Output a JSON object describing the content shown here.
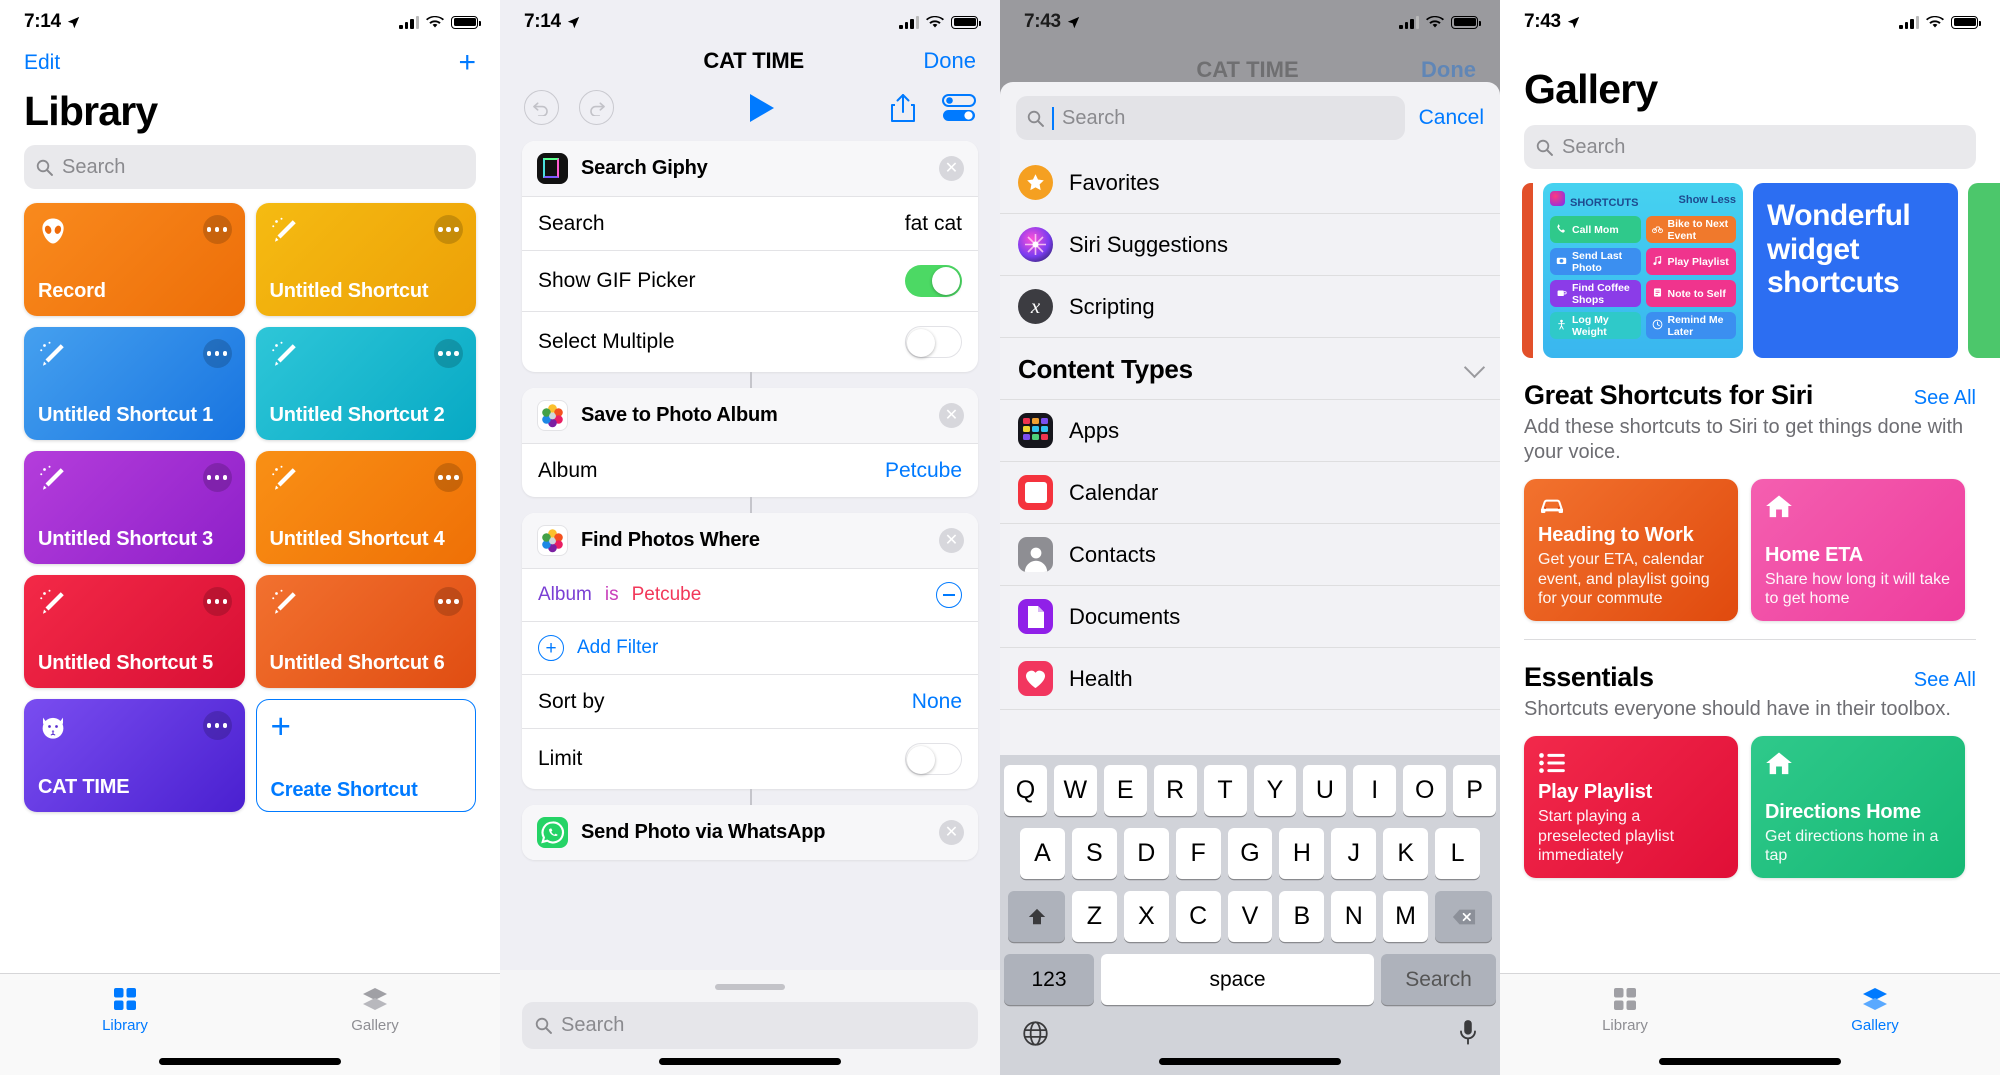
{
  "panel1": {
    "status": {
      "time": "7:14",
      "location_icon": "location-arrow-icon",
      "battery": "battery-full-icon"
    },
    "nav": {
      "edit": "Edit",
      "add": "+"
    },
    "title": "Library",
    "search": {
      "placeholder": "Search",
      "icon": "search-icon"
    },
    "cards": [
      {
        "label": "Record",
        "icon": "alien-icon",
        "c1": "#f98a1d",
        "c2": "#ed6e09"
      },
      {
        "label": "Untitled Shortcut",
        "icon": "wand-icon",
        "c1": "#f5bb12",
        "c2": "#eda007"
      },
      {
        "label": "Untitled Shortcut 1",
        "icon": "wand-icon",
        "c1": "#45a0ef",
        "c2": "#1874e0"
      },
      {
        "label": "Untitled Shortcut 2",
        "icon": "wand-icon",
        "c1": "#2ec6d8",
        "c2": "#07a9c4"
      },
      {
        "label": "Untitled Shortcut 3",
        "icon": "wand-icon",
        "c1": "#b43ddb",
        "c2": "#8e20c9"
      },
      {
        "label": "Untitled Shortcut 4",
        "icon": "wand-icon",
        "c1": "#f99015",
        "c2": "#ef7006"
      },
      {
        "label": "Untitled Shortcut 5",
        "icon": "wand-icon",
        "c1": "#f32947",
        "c2": "#d80f35"
      },
      {
        "label": "Untitled Shortcut 6",
        "icon": "wand-icon",
        "c1": "#f2712f",
        "c2": "#e04d12"
      },
      {
        "label": "CAT TIME",
        "icon": "cat-icon",
        "c1": "#7a4df0",
        "c2": "#4a20d0"
      }
    ],
    "create": {
      "label": "Create Shortcut",
      "plus": "+"
    },
    "tabs": [
      {
        "label": "Library",
        "icon": "grid-icon",
        "active": true
      },
      {
        "label": "Gallery",
        "icon": "layers-icon",
        "active": false
      }
    ]
  },
  "panel2": {
    "status": {
      "time": "7:14"
    },
    "nav": {
      "title": "CAT TIME",
      "done": "Done"
    },
    "toolbar": {
      "undo": "undo-icon",
      "redo": "redo-icon",
      "play": "play-icon",
      "share": "share-icon",
      "settings": "toggles-icon"
    },
    "blocks": [
      {
        "app_icon": "giphy-icon",
        "name": "Search Giphy",
        "rows": [
          {
            "type": "value",
            "label": "Search",
            "value": "fat cat"
          },
          {
            "type": "toggle",
            "label": "Show GIF Picker",
            "on": true
          },
          {
            "type": "toggle",
            "label": "Select Multiple",
            "on": false
          }
        ]
      },
      {
        "app_icon": "photos-icon",
        "name": "Save to Photo Album",
        "rows": [
          {
            "type": "value",
            "label": "Album",
            "value": "Petcube",
            "blue": true
          }
        ]
      },
      {
        "app_icon": "photos-icon",
        "name": "Find Photos Where",
        "filter": {
          "field": "Album",
          "op": "is",
          "value": "Petcube"
        },
        "add_filter": "Add Filter",
        "rows": [
          {
            "type": "value",
            "label": "Sort by",
            "value": "None",
            "blue": true
          },
          {
            "type": "toggle",
            "label": "Limit",
            "on": false
          }
        ]
      },
      {
        "app_icon": "whatsapp-icon",
        "name": "Send Photo via WhatsApp",
        "rows": []
      }
    ],
    "bottom_search": {
      "placeholder": "Search",
      "icon": "search-icon"
    }
  },
  "panel3": {
    "status": {
      "time": "7:43"
    },
    "ghost_nav": {
      "title": "CAT TIME",
      "done": "Done"
    },
    "search": {
      "placeholder": "Search",
      "icon": "search-icon",
      "cancel": "Cancel"
    },
    "top_items": [
      {
        "label": "Favorites",
        "icon": "star-icon"
      },
      {
        "label": "Siri Suggestions",
        "icon": "siri-icon"
      },
      {
        "label": "Scripting",
        "icon": "scripting-x-icon"
      }
    ],
    "section": {
      "title": "Content Types",
      "chevron": "chevron-down-icon"
    },
    "content_types": [
      {
        "label": "Apps",
        "icon": "apps-grid-icon"
      },
      {
        "label": "Calendar",
        "icon": "calendar-icon"
      },
      {
        "label": "Contacts",
        "icon": "contacts-icon"
      },
      {
        "label": "Documents",
        "icon": "documents-icon"
      },
      {
        "label": "Health",
        "icon": "health-heart-icon"
      }
    ],
    "keyboard": {
      "row1": [
        "Q",
        "W",
        "E",
        "R",
        "T",
        "Y",
        "U",
        "I",
        "O",
        "P"
      ],
      "row2": [
        "A",
        "S",
        "D",
        "F",
        "G",
        "H",
        "J",
        "K",
        "L"
      ],
      "row3": [
        "Z",
        "X",
        "C",
        "V",
        "B",
        "N",
        "M"
      ],
      "shift": "shift-icon",
      "backspace": "backspace-icon",
      "numbers": "123",
      "space": "space",
      "go": "Search",
      "globe": "globe-icon",
      "mic": "microphone-icon"
    }
  },
  "panel4": {
    "status": {
      "time": "7:43"
    },
    "title": "Gallery",
    "search": {
      "placeholder": "Search",
      "icon": "search-icon"
    },
    "hero_widget": {
      "header": "SHORTCUTS",
      "show_less": "Show Less",
      "pills": [
        {
          "label": "Call Mom",
          "icon": "phone-icon",
          "color": "#2fc98b"
        },
        {
          "label": "Bike to Next Event",
          "icon": "bike-icon",
          "color": "#f0792c"
        },
        {
          "label": "Send Last Photo",
          "icon": "camera-icon",
          "color": "#3b8ff0"
        },
        {
          "label": "Play Playlist",
          "icon": "music-icon",
          "color": "#f0348d"
        },
        {
          "label": "Find Coffee Shops",
          "icon": "coffee-icon",
          "color": "#8b3ce8"
        },
        {
          "label": "Note to Self",
          "icon": "note-icon",
          "color": "#f0348d"
        },
        {
          "label": "Log My Weight",
          "icon": "person-icon",
          "color": "#2fc9c9"
        },
        {
          "label": "Remind Me Later",
          "icon": "clock-icon",
          "color": "#3b8ff0"
        }
      ]
    },
    "blue_card": "Wonderful widget shortcuts",
    "sections": [
      {
        "title": "Great Shortcuts for Siri",
        "see_all": "See All",
        "subtitle": "Add these shortcuts to Siri to get things done with your voice.",
        "cards": [
          {
            "title": "Heading to Work",
            "desc": "Get your ETA, calendar event, and playlist going for your commute",
            "icon": "car-icon",
            "c1": "#f2722e",
            "c2": "#e04a0e"
          },
          {
            "title": "Home ETA",
            "desc": "Share how long it will take to get home",
            "icon": "house-icon",
            "c1": "#f45fb0",
            "c2": "#ee3d9d"
          }
        ]
      },
      {
        "title": "Essentials",
        "see_all": "See All",
        "subtitle": "Shortcuts everyone should have in their toolbox.",
        "cards": [
          {
            "title": "Play Playlist",
            "desc": "Start playing a preselected playlist immediately",
            "icon": "list-icon",
            "c1": "#f2294b",
            "c2": "#e00f37"
          },
          {
            "title": "Directions Home",
            "desc": "Get directions home in a tap",
            "icon": "house-icon",
            "c1": "#2fc98b",
            "c2": "#16b874"
          }
        ]
      }
    ],
    "tabs": [
      {
        "label": "Library",
        "icon": "grid-icon",
        "active": false
      },
      {
        "label": "Gallery",
        "icon": "layers-icon",
        "active": true
      }
    ]
  }
}
